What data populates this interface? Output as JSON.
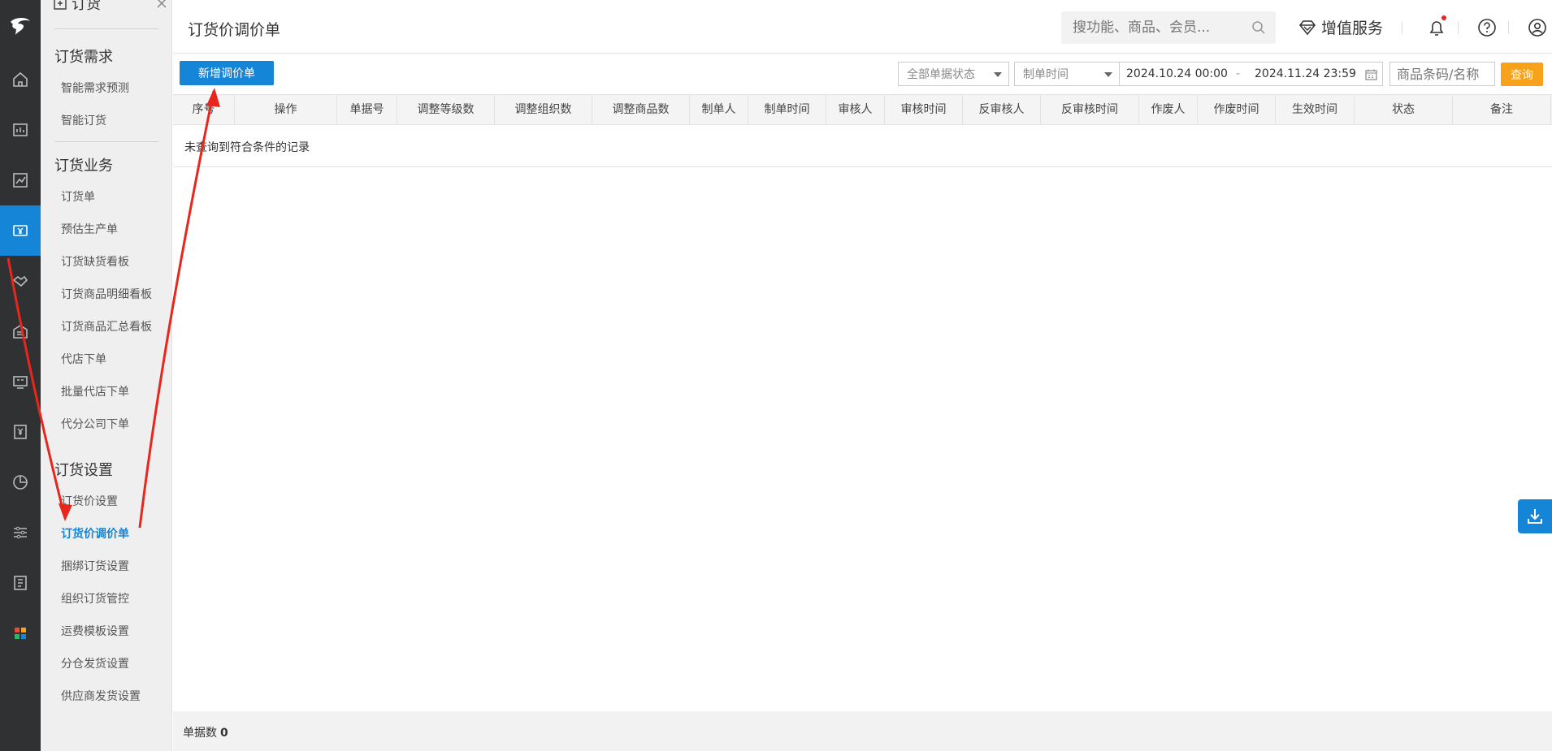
{
  "submenu": {
    "top_title": "订货",
    "sections": [
      {
        "title": "订货需求",
        "items": [
          "智能需求预测",
          "智能订货"
        ]
      },
      {
        "title": "订货业务",
        "items": [
          "订货单",
          "预估生产单",
          "订货缺货看板",
          "订货商品明细看板",
          "订货商品汇总看板",
          "代店下单",
          "批量代店下单",
          "代分公司下单"
        ]
      },
      {
        "title": "订货设置",
        "items": [
          "订货价设置",
          "订货价调价单",
          "捆绑订货设置",
          "组织订货管控",
          "运费模板设置",
          "分仓发货设置",
          "供应商发货设置"
        ]
      }
    ],
    "active_item": "订货价调价单"
  },
  "header": {
    "title": "订货价调价单",
    "search_placeholder": "搜功能、商品、会员...",
    "value_service": "增值服务"
  },
  "toolbar": {
    "new_button": "新增调价单",
    "status_select": "全部单据状态",
    "time_select": "制单时间",
    "date_start": "2024.10.24 00:00",
    "date_sep": "-",
    "date_end": "2024.11.24 23:59",
    "item_placeholder": "商品条码/名称",
    "query_button": "查询"
  },
  "table": {
    "columns": [
      "序号",
      "操作",
      "单据号",
      "调整等级数",
      "调整组织数",
      "调整商品数",
      "制单人",
      "制单时间",
      "审核人",
      "审核时间",
      "反审核人",
      "反审核时间",
      "作废人",
      "作废时间",
      "生效时间",
      "状态",
      "备注"
    ],
    "empty_text": "未查询到符合条件的记录"
  },
  "footer": {
    "count_label": "单据数",
    "count_value": "0"
  },
  "colors": {
    "accent": "#1585d8",
    "query": "#f7a21a",
    "rail": "#2f3133",
    "annotation": "#e8261c"
  }
}
